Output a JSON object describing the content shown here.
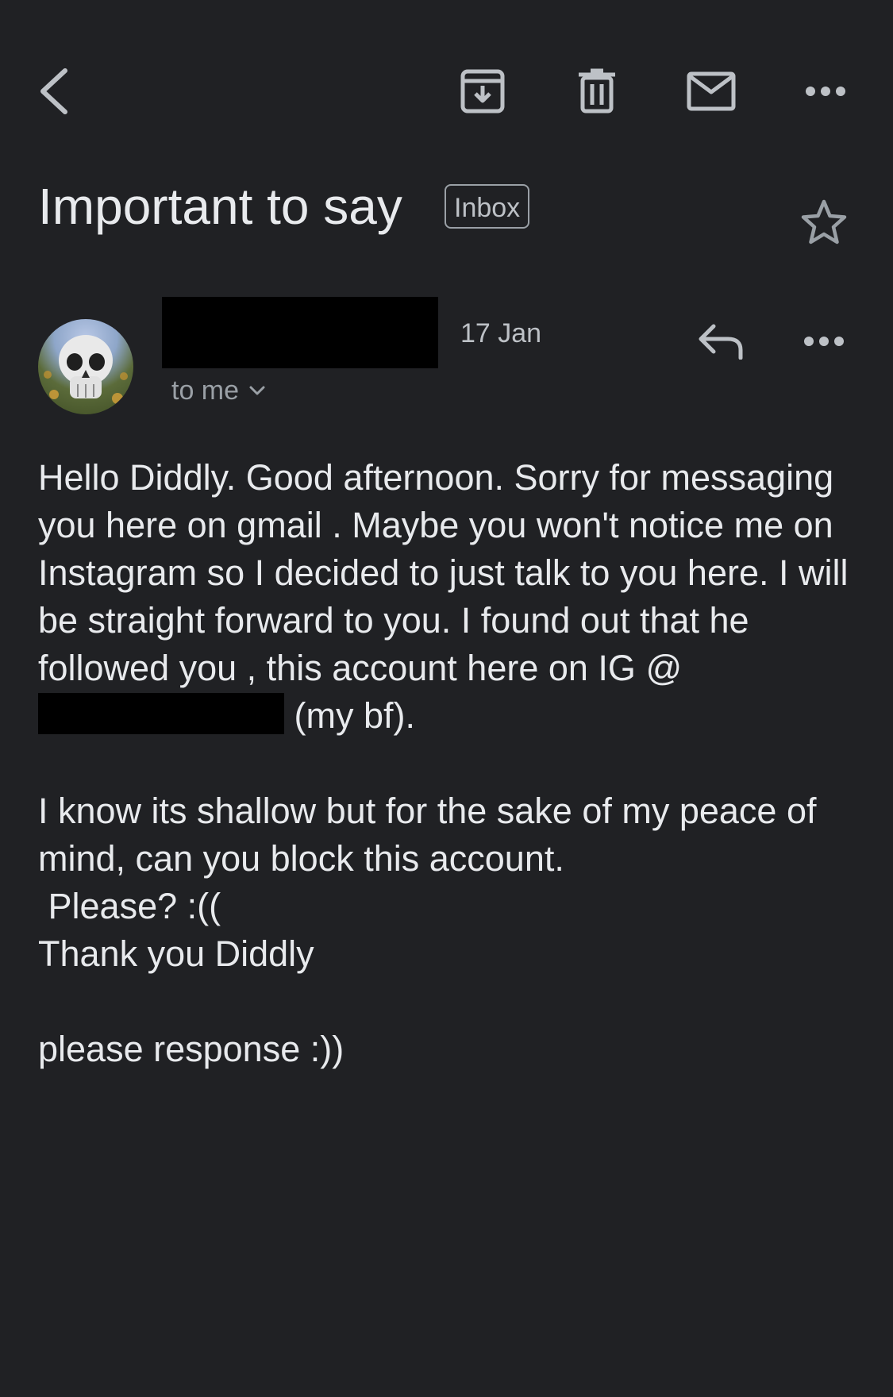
{
  "toolbar": {
    "back_icon": "back-arrow-icon",
    "archive_icon": "archive-icon",
    "delete_icon": "trash-icon",
    "mark_unread_icon": "mail-icon",
    "more_icon": "more-horizontal-icon"
  },
  "email": {
    "subject": "Important to say",
    "label": "Inbox",
    "starred": false,
    "date": "17 Jan",
    "recipient_text": "to me",
    "body": {
      "paragraph1_before_redaction": "Hello Diddly. Good afternoon. Sorry for messaging you here on gmail . Maybe you won't notice me on Instagram so I decided to just talk to you here. I will be straight forward to you. I found out that he followed you , this account here on IG @",
      "paragraph1_after_redaction": " (my bf).",
      "paragraph2": "I know its shallow but for the sake of my peace of mind, can you block this account.\n Please? :((\nThank you Diddly",
      "paragraph3": "please response :))"
    }
  },
  "colors": {
    "background": "#202124",
    "text_primary": "#e8eaed",
    "text_secondary": "#9aa0a6",
    "redaction": "#000000"
  }
}
